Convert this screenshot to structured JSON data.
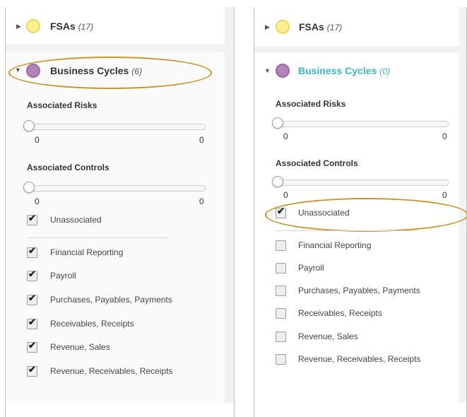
{
  "left": {
    "fsa": {
      "title": "FSAs",
      "count": "(17)"
    },
    "bc": {
      "title": "Business Cycles",
      "count": "(6)"
    },
    "risks": {
      "label": "Associated Risks",
      "min": "0",
      "max": "0",
      "value": 0
    },
    "controls": {
      "label": "Associated Controls",
      "min": "0",
      "max": "0",
      "value": 0
    },
    "unassociated": {
      "label": "Unassociated",
      "checked": true
    },
    "items": [
      {
        "label": "Financial Reporting",
        "checked": true
      },
      {
        "label": "Payroll",
        "checked": true
      },
      {
        "label": "Purchases, Payables, Payments",
        "checked": true
      },
      {
        "label": "Receivables, Receipts",
        "checked": true
      },
      {
        "label": "Revenue, Sales",
        "checked": true
      },
      {
        "label": "Revenue, Receivables, Receipts",
        "checked": true
      }
    ]
  },
  "right": {
    "fsa": {
      "title": "FSAs",
      "count": "(17)"
    },
    "bc": {
      "title": "Business Cycles",
      "count": "(0)"
    },
    "risks": {
      "label": "Associated Risks",
      "min": "0",
      "max": "0",
      "value": 0
    },
    "controls": {
      "label": "Associated Controls",
      "min": "0",
      "max": "0",
      "value": 0
    },
    "unassociated": {
      "label": "Unassociated",
      "checked": true
    },
    "items": [
      {
        "label": "Financial Reporting",
        "checked": false
      },
      {
        "label": "Payroll",
        "checked": false
      },
      {
        "label": "Purchases, Payables, Payments",
        "checked": false
      },
      {
        "label": "Receivables, Receipts",
        "checked": false
      },
      {
        "label": "Revenue, Sales",
        "checked": false
      },
      {
        "label": "Revenue, Receivables, Receipts",
        "checked": false
      }
    ]
  },
  "colors": {
    "accent_teal": "#3bb7c4",
    "highlight": "#c3942a",
    "fsa_dot": "#fdf08f",
    "bc_dot": "#b083b9"
  },
  "icons": {
    "collapsed": "caret-right-icon",
    "expanded": "caret-down-icon",
    "check": "checkmark-icon"
  }
}
